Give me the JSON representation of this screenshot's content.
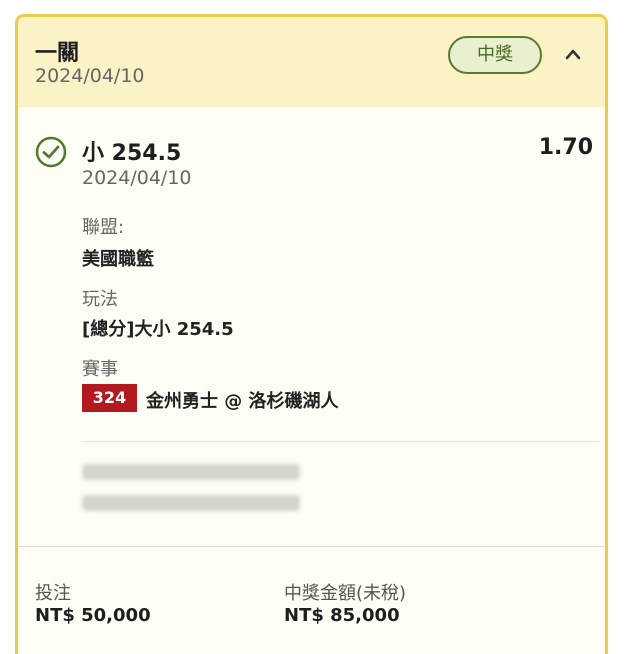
{
  "header": {
    "title": "一關",
    "date": "2024/04/10",
    "status_badge": "中獎",
    "collapse_icon": "chevron-up-icon"
  },
  "selection": {
    "status_icon": "check-circle-icon",
    "pick": "小 254.5",
    "date": "2024/04/10",
    "odds": "1.70"
  },
  "details": {
    "league_label": "聯盟:",
    "league_value": "美國職籃",
    "market_label": "玩法",
    "market_value": "[總分]大小 254.5",
    "event_label": "賽事",
    "event_number": "324",
    "event_name": "金州勇士 @ 洛杉磯湖人"
  },
  "footer": {
    "stake_label": "投注",
    "stake_value": "NT$ 50,000",
    "payout_label": "中獎金額(未稅)",
    "payout_value": "NT$ 85,000"
  },
  "colors": {
    "card_border": "#e9cc4a",
    "header_bg": "#fbf2c6",
    "badge_border": "#5a7a2d",
    "badge_bg": "#e8f0cf",
    "event_badge_bg": "#b21820",
    "check_color": "#4f7a2c"
  }
}
